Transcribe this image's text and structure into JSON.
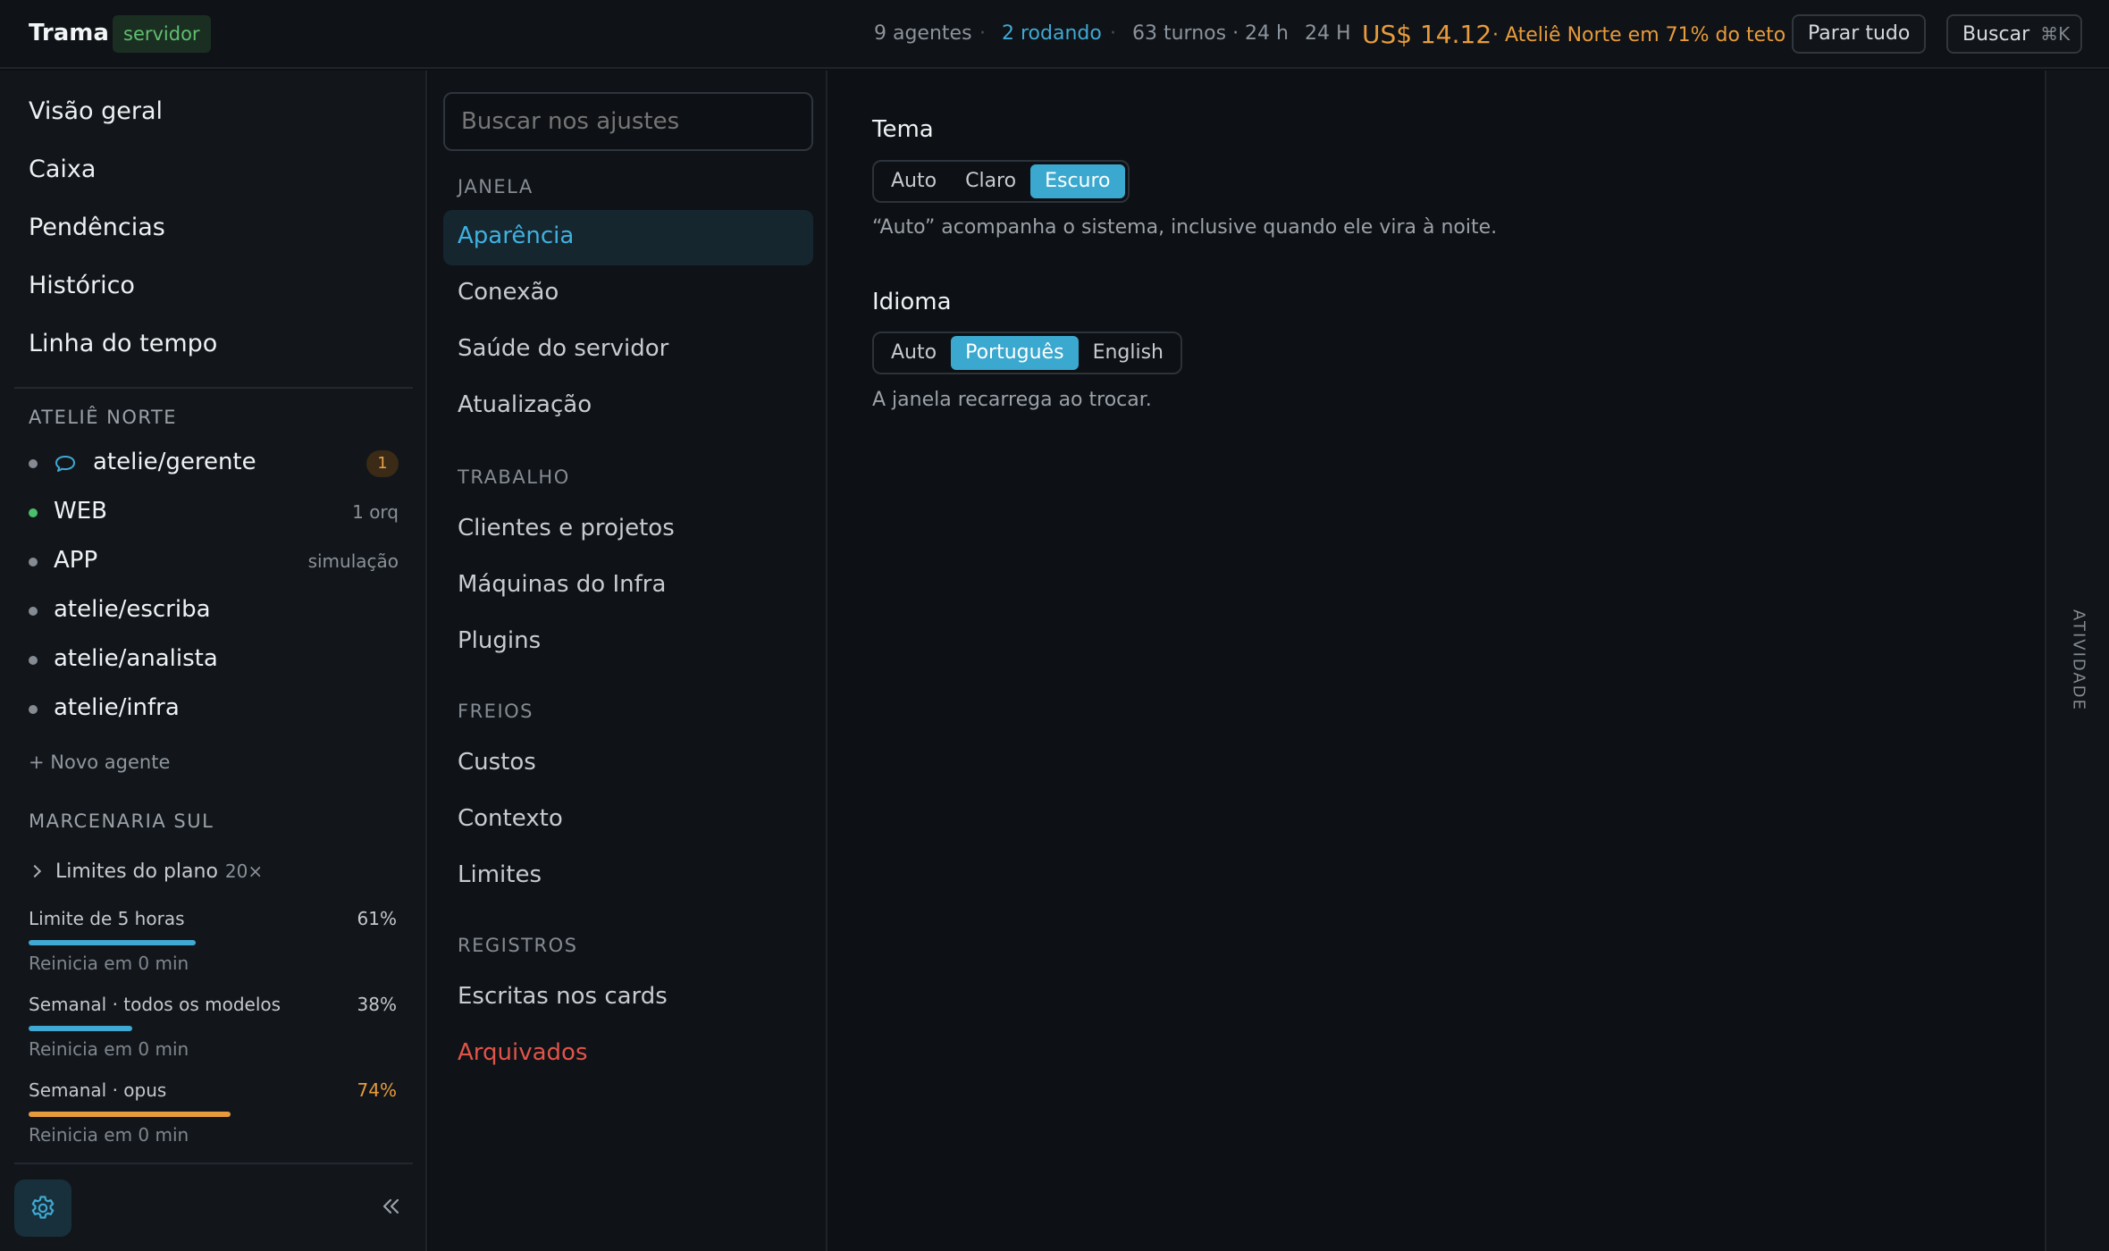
{
  "header": {
    "app_title": "Trama",
    "server_badge": "servidor",
    "agents_count": "9 agentes",
    "running": "2 rodando",
    "turns": "63 turnos · 24 h",
    "period": "24 H",
    "cost": "US$ 14.12",
    "budget_warning": "· Ateliê Norte em 71% do teto",
    "stop_all": "Parar tudo",
    "search": "Buscar",
    "search_shortcut": "⌘K"
  },
  "sidebar": {
    "nav": [
      "Visão geral",
      "Caixa",
      "Pendências",
      "Histórico",
      "Linha do tempo"
    ],
    "group1": {
      "title": "ATELIÊ NORTE",
      "agents": [
        {
          "name": "atelie/gerente",
          "badge": "1",
          "status": "idle",
          "icon": "chat-bubble-icon"
        },
        {
          "name": "WEB",
          "meta": "1 orq",
          "status": "running"
        },
        {
          "name": "APP",
          "meta": "simulação",
          "status": "idle"
        },
        {
          "name": "atelie/escriba",
          "status": "idle"
        },
        {
          "name": "atelie/analista",
          "status": "idle"
        },
        {
          "name": "atelie/infra",
          "status": "idle"
        }
      ],
      "new_agent": "+ Novo agente"
    },
    "group2": {
      "title": "MARCENARIA SUL",
      "limits_title": "Limites do plano",
      "limits_multiplier": "20×",
      "limits": [
        {
          "label": "Limite de 5 horas",
          "pct": "61%",
          "fraction": 0.61,
          "reset": "Reinicia em 0 min"
        },
        {
          "label": "Semanal · todos os modelos",
          "pct": "38%",
          "fraction": 0.38,
          "reset": "Reinicia em 0 min"
        },
        {
          "label": "Semanal · opus",
          "pct": "74%",
          "fraction": 0.74,
          "reset": "Reinicia em 0 min",
          "warn": true
        }
      ]
    }
  },
  "settings_nav": {
    "search_placeholder": "Buscar nos ajustes",
    "sections": [
      {
        "title": "JANELA",
        "items": [
          "Aparência",
          "Conexão",
          "Saúde do servidor",
          "Atualização"
        ]
      },
      {
        "title": "TRABALHO",
        "items": [
          "Clientes e projetos",
          "Máquinas do Infra",
          "Plugins"
        ]
      },
      {
        "title": "FREIOS",
        "items": [
          "Custos",
          "Contexto",
          "Limites"
        ]
      },
      {
        "title": "REGISTROS",
        "items": [
          "Escritas nos cards",
          "Arquivados"
        ]
      }
    ],
    "active_item": "Aparência"
  },
  "appearance": {
    "theme": {
      "title": "Tema",
      "options": [
        "Auto",
        "Claro",
        "Escuro"
      ],
      "selected": "Escuro",
      "hint": "“Auto” acompanha o sistema, inclusive quando ele vira à noite."
    },
    "language": {
      "title": "Idioma",
      "options": [
        "Auto",
        "Português",
        "English"
      ],
      "selected": "Português",
      "hint": "A janela recarrega ao trocar."
    }
  },
  "activity_panel": {
    "label": "ATIVIDADE"
  },
  "colors": {
    "accent": "#3fa9d3",
    "warning": "#e79b3c",
    "success": "#4bbf6b",
    "danger": "#e0544a"
  }
}
